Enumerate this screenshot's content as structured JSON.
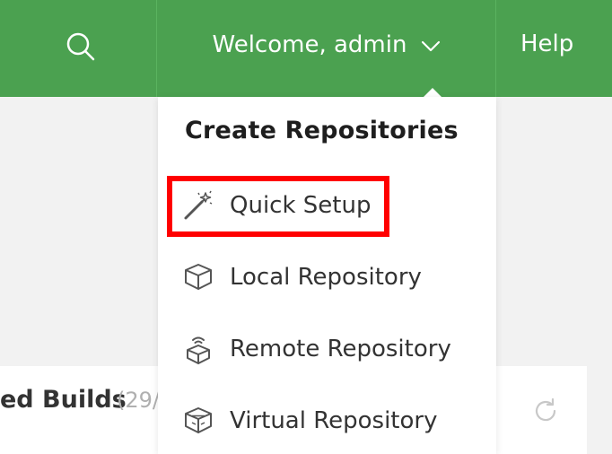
{
  "header": {
    "search_icon": "search-icon",
    "welcome_label": "Welcome, admin",
    "help_label": "Help",
    "colors": {
      "bar": "#4ba150",
      "text": "#ffffff"
    }
  },
  "dropdown": {
    "title": "Create Repositories",
    "items": [
      {
        "label": "Quick Setup",
        "icon": "magic-wand-icon",
        "highlighted": true
      },
      {
        "label": "Local Repository",
        "icon": "box-icon"
      },
      {
        "label": "Remote Repository",
        "icon": "remote-box-icon"
      },
      {
        "label": "Virtual Repository",
        "icon": "virtual-box-icon"
      }
    ],
    "highlight_color": "#ff0000"
  },
  "background_card": {
    "title": "ed Builds",
    "count": "(29/",
    "refresh_icon": "refresh-icon"
  }
}
